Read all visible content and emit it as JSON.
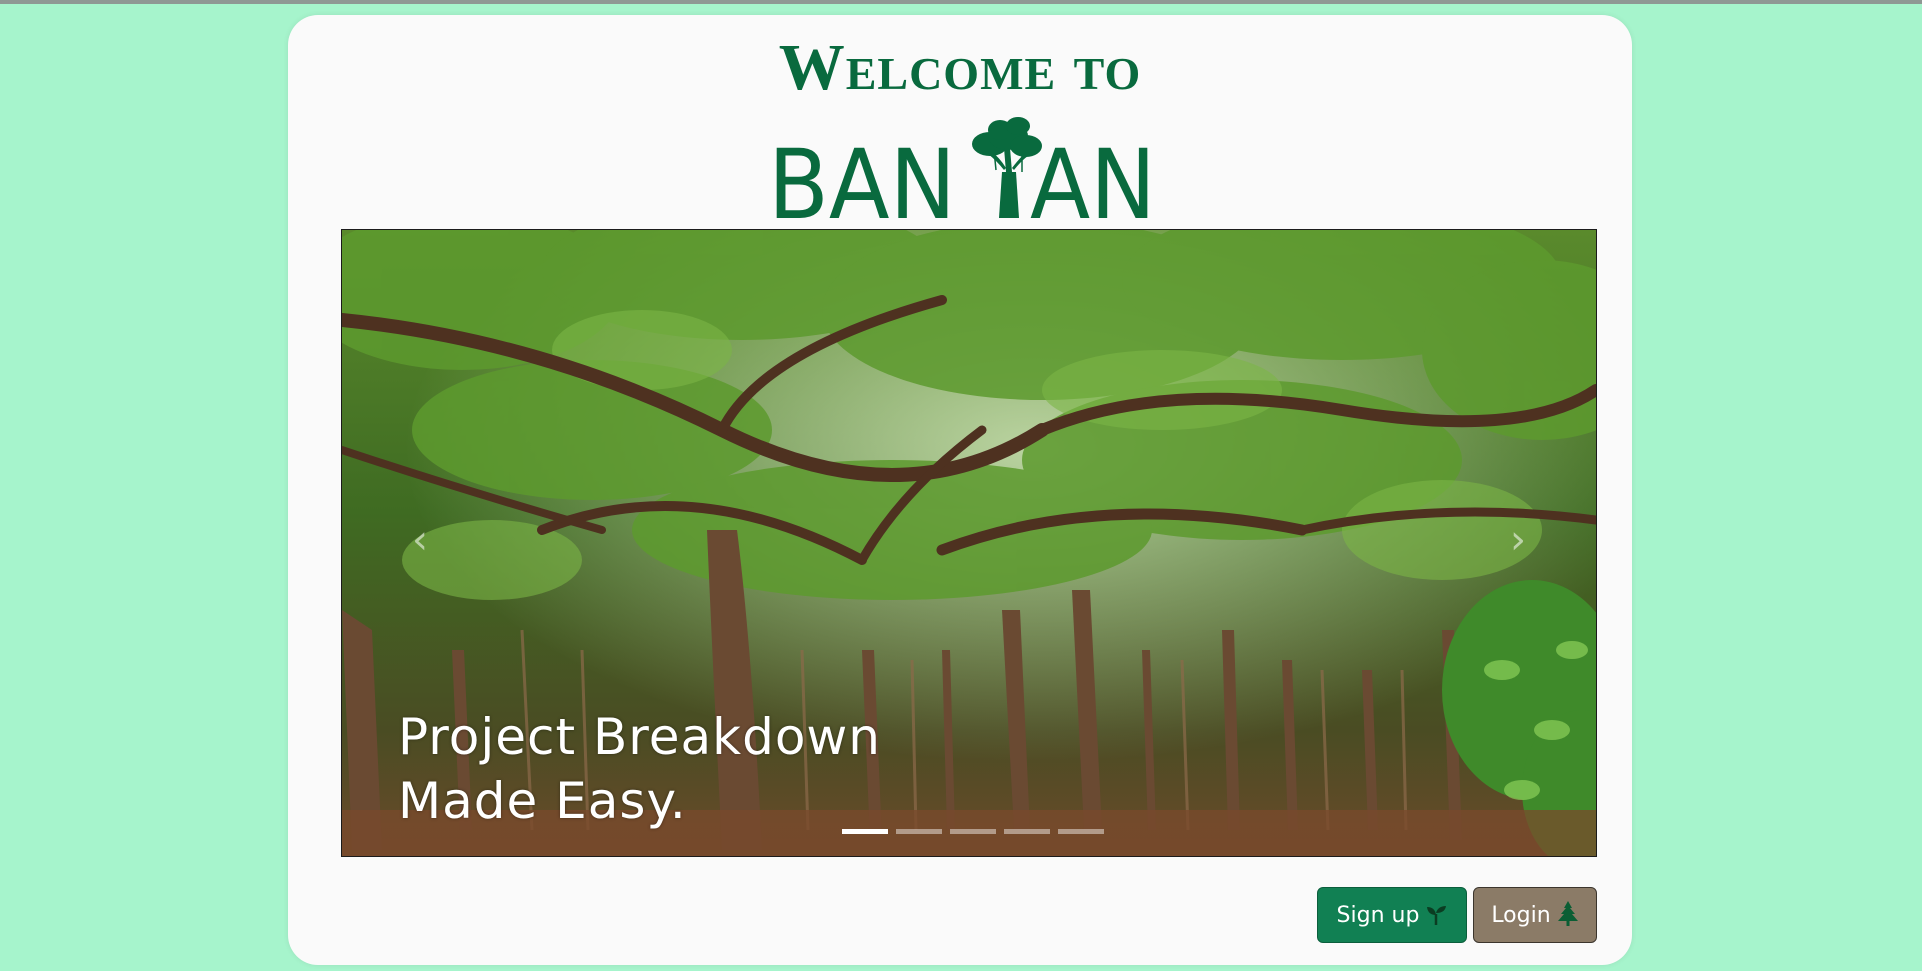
{
  "header": {
    "welcome": "Welcome to",
    "brand": "BANYAN",
    "brand_color": "#096a3e"
  },
  "carousel": {
    "caption_line1": "Project Breakdown",
    "caption_line2": "Made Easy.",
    "slide_count": 5,
    "active_slide": 0,
    "prev_icon": "chevron-left-icon",
    "next_icon": "chevron-right-icon"
  },
  "actions": {
    "signup_label": "Sign up",
    "signup_icon": "sprout-icon",
    "login_label": "Login",
    "login_icon": "tree-icon"
  },
  "colors": {
    "page_bg": "#a6f4cc",
    "card_bg": "#fafafa",
    "signup_bg": "#118053",
    "login_bg": "#8b7b67"
  }
}
